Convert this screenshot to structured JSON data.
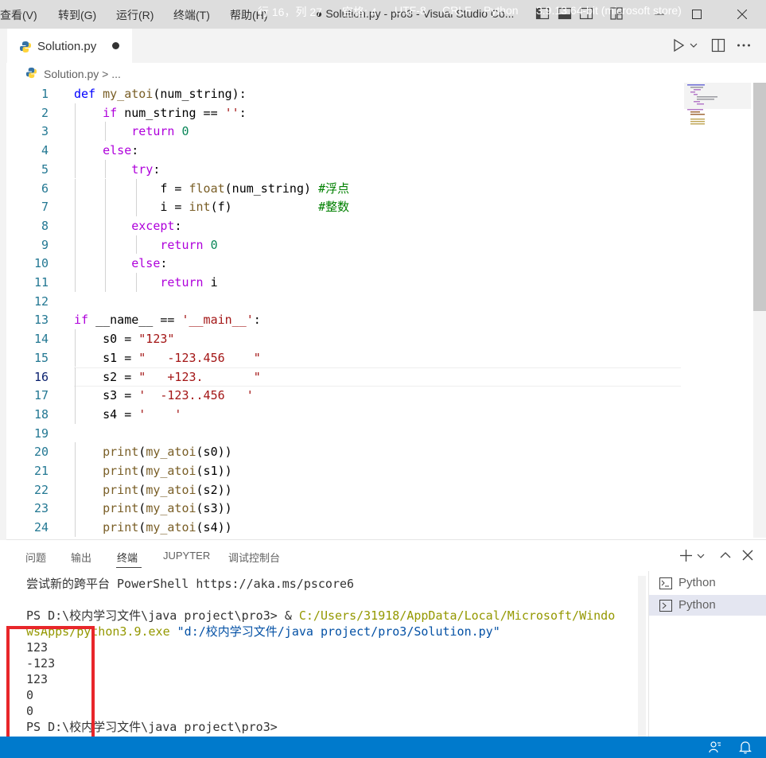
{
  "menu": [
    "查看(V)",
    "转到(G)",
    "运行(R)",
    "终端(T)",
    "帮助(H)"
  ],
  "window_title": "● Solution.py - pro3 - Visual Studio Co...",
  "tab": {
    "label": "Solution.py"
  },
  "breadcrumb": {
    "file": "Solution.py",
    "rest": "> ..."
  },
  "code_lines": [
    {
      "n": "1",
      "code": [
        [
          "kw",
          "def "
        ],
        [
          "fn",
          "my_atoi"
        ],
        [
          "",
          "(num_string):"
        ]
      ]
    },
    {
      "n": "2",
      "code": [
        [
          "",
          "    "
        ],
        [
          "kw2",
          "if"
        ],
        [
          "",
          " num_string == "
        ],
        [
          "str",
          "''"
        ],
        [
          "",
          ":"
        ]
      ]
    },
    {
      "n": "3",
      "code": [
        [
          "",
          "        "
        ],
        [
          "kw2",
          "return"
        ],
        [
          "",
          ""
        ],
        [
          "num",
          " 0"
        ]
      ]
    },
    {
      "n": "4",
      "code": [
        [
          "",
          "    "
        ],
        [
          "kw2",
          "else"
        ],
        [
          "",
          ":"
        ]
      ]
    },
    {
      "n": "5",
      "code": [
        [
          "",
          "        "
        ],
        [
          "kw2",
          "try"
        ],
        [
          "",
          ":"
        ]
      ]
    },
    {
      "n": "6",
      "code": [
        [
          "",
          "            f = "
        ],
        [
          "fn",
          "float"
        ],
        [
          "",
          "(num_string) "
        ],
        [
          "cm",
          "#浮点"
        ]
      ]
    },
    {
      "n": "7",
      "code": [
        [
          "",
          "            i = "
        ],
        [
          "fn",
          "int"
        ],
        [
          "",
          "(f)            "
        ],
        [
          "cm",
          "#整数"
        ]
      ]
    },
    {
      "n": "8",
      "code": [
        [
          "",
          "        "
        ],
        [
          "kw2",
          "except"
        ],
        [
          "",
          ":"
        ]
      ]
    },
    {
      "n": "9",
      "code": [
        [
          "",
          "            "
        ],
        [
          "kw2",
          "return"
        ],
        [
          "num",
          " 0"
        ]
      ]
    },
    {
      "n": "10",
      "code": [
        [
          "",
          "        "
        ],
        [
          "kw2",
          "else"
        ],
        [
          "",
          ":"
        ]
      ]
    },
    {
      "n": "11",
      "code": [
        [
          "",
          "            "
        ],
        [
          "kw2",
          "return"
        ],
        [
          "",
          " i"
        ]
      ]
    },
    {
      "n": "12",
      "code": [
        [
          "",
          ""
        ]
      ]
    },
    {
      "n": "13",
      "code": [
        [
          "kw2",
          "if"
        ],
        [
          "",
          " __name__ == "
        ],
        [
          "str",
          "'__main__'"
        ],
        [
          "",
          ":"
        ]
      ]
    },
    {
      "n": "14",
      "code": [
        [
          "",
          "    s0 = "
        ],
        [
          "str",
          "\"123\""
        ]
      ]
    },
    {
      "n": "15",
      "code": [
        [
          "",
          "    s1 = "
        ],
        [
          "str",
          "\"   -123.456    \""
        ]
      ]
    },
    {
      "n": "16",
      "code": [
        [
          "",
          "    s2 = "
        ],
        [
          "str",
          "\"   +123.       \""
        ]
      ]
    },
    {
      "n": "17",
      "code": [
        [
          "",
          "    s3 = "
        ],
        [
          "str",
          "'  -123..456   '"
        ]
      ]
    },
    {
      "n": "18",
      "code": [
        [
          "",
          "    s4 = "
        ],
        [
          "str",
          "'    '"
        ]
      ]
    },
    {
      "n": "19",
      "code": [
        [
          "",
          ""
        ]
      ]
    },
    {
      "n": "20",
      "code": [
        [
          "",
          "    "
        ],
        [
          "fn",
          "print"
        ],
        [
          "",
          "("
        ],
        [
          "fn",
          "my_atoi"
        ],
        [
          "",
          "(s0))"
        ]
      ]
    },
    {
      "n": "21",
      "code": [
        [
          "",
          "    "
        ],
        [
          "fn",
          "print"
        ],
        [
          "",
          "("
        ],
        [
          "fn",
          "my_atoi"
        ],
        [
          "",
          "(s1))"
        ]
      ]
    },
    {
      "n": "22",
      "code": [
        [
          "",
          "    "
        ],
        [
          "fn",
          "print"
        ],
        [
          "",
          "("
        ],
        [
          "fn",
          "my_atoi"
        ],
        [
          "",
          "(s2))"
        ]
      ]
    },
    {
      "n": "23",
      "code": [
        [
          "",
          "    "
        ],
        [
          "fn",
          "print"
        ],
        [
          "",
          "("
        ],
        [
          "fn",
          "my_atoi"
        ],
        [
          "",
          "(s3))"
        ]
      ]
    },
    {
      "n": "24",
      "code": [
        [
          "",
          "    "
        ],
        [
          "fn",
          "print"
        ],
        [
          "",
          "("
        ],
        [
          "fn",
          "my_atoi"
        ],
        [
          "",
          "(s4))"
        ]
      ]
    }
  ],
  "current_line": "16",
  "panel_tabs": [
    "问题",
    "输出",
    "终端",
    "JUPYTER",
    "调试控制台"
  ],
  "active_panel_tab": "终端",
  "terminal": {
    "banner": "尝试新的跨平台 PowerShell https://aka.ms/pscore6",
    "prompt1": "PS D:\\校内学习文件\\java project\\pro3> ",
    "cmd_amp": "& ",
    "cmd_exe_a": "C:/Users/31918/AppData/Local/Microsoft/Windo",
    "cmd_exe_b": "wsApps/python3.9.exe",
    "cmd_arg": " \"d:/校内学习文件/java project/pro3/Solution.py\"",
    "outputs": [
      "123",
      "-123",
      "123",
      "0",
      "0"
    ],
    "prompt2": "PS D:\\校内学习文件\\java project\\pro3>"
  },
  "terminal_list": [
    "Python",
    "Python"
  ],
  "status": {
    "position": "行 16，列 27",
    "spaces": "空格: 4",
    "encoding": "UTF-8",
    "eol": "CRLF",
    "language": "Python",
    "interpreter": "3.9.13 64-bit (microsoft store)"
  }
}
